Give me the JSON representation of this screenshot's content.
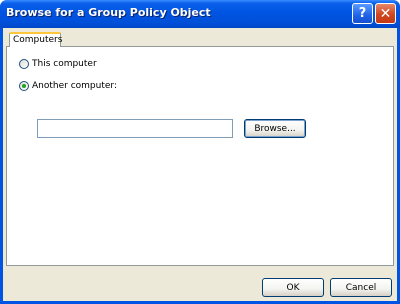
{
  "window": {
    "title": "Browse for a Group Policy Object",
    "help_label": "?",
    "close_label": "✕"
  },
  "tabs": [
    {
      "label": "Computers",
      "selected": true
    }
  ],
  "options": {
    "this_computer": {
      "label": "This computer",
      "checked": false
    },
    "another_computer": {
      "label": "Another computer:",
      "checked": true
    }
  },
  "computer_name": {
    "value": "",
    "placeholder": ""
  },
  "buttons": {
    "browse": "Browse...",
    "ok": "OK",
    "cancel": "Cancel"
  },
  "colors": {
    "titlebar": "#0054e3",
    "client": "#ece9d8",
    "radio_dot": "#21a121",
    "tab_highlight": "#ffc83c"
  }
}
